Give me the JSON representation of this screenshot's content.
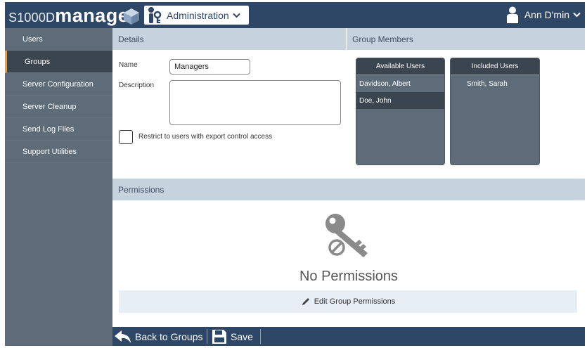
{
  "app": {
    "brand_prefix": "S1000D",
    "brand_name": "manager",
    "module_menu": "Administration",
    "user_name": "Ann D'min"
  },
  "sidebar": {
    "items": [
      {
        "label": "Users",
        "active": false
      },
      {
        "label": "Groups",
        "active": true
      },
      {
        "label": "Server Configuration",
        "active": false
      },
      {
        "label": "Server Cleanup",
        "active": false
      },
      {
        "label": "Send Log Files",
        "active": false
      },
      {
        "label": "Support Utilities",
        "active": false
      }
    ]
  },
  "details": {
    "header": "Details",
    "name_label": "Name",
    "name_value": "Managers",
    "description_label": "Description",
    "description_value": "",
    "restrict_label": "Restrict to users with export control access",
    "restrict_checked": false
  },
  "members": {
    "header": "Group Members",
    "available": {
      "title": "Available Users",
      "users": [
        "Davidson, Albert",
        "Doe, John"
      ],
      "selected": "Doe, John"
    },
    "included": {
      "title": "Included Users",
      "users": [
        "Smith, Sarah"
      ]
    }
  },
  "permissions": {
    "header": "Permissions",
    "empty_text": "No Permissions",
    "edit_label": "Edit Group Permissions"
  },
  "footer": {
    "back_label": "Back to Groups",
    "save_label": "Save"
  },
  "colors": {
    "topbar": "#2f4767",
    "sidebar": "#5e6b78",
    "sidebar_active": "#3b4550",
    "accent": "#ff9b1f",
    "section_header": "#c7d2df"
  },
  "icons": {
    "brand": "cube-icon",
    "admin": "admin-keys-icon",
    "user": "person-icon",
    "dropdown": "chevron-down-icon",
    "empty_permissions": "key-disabled-icon",
    "edit": "pencil-icon",
    "back": "back-arrow-icon",
    "save": "floppy-disk-icon"
  }
}
